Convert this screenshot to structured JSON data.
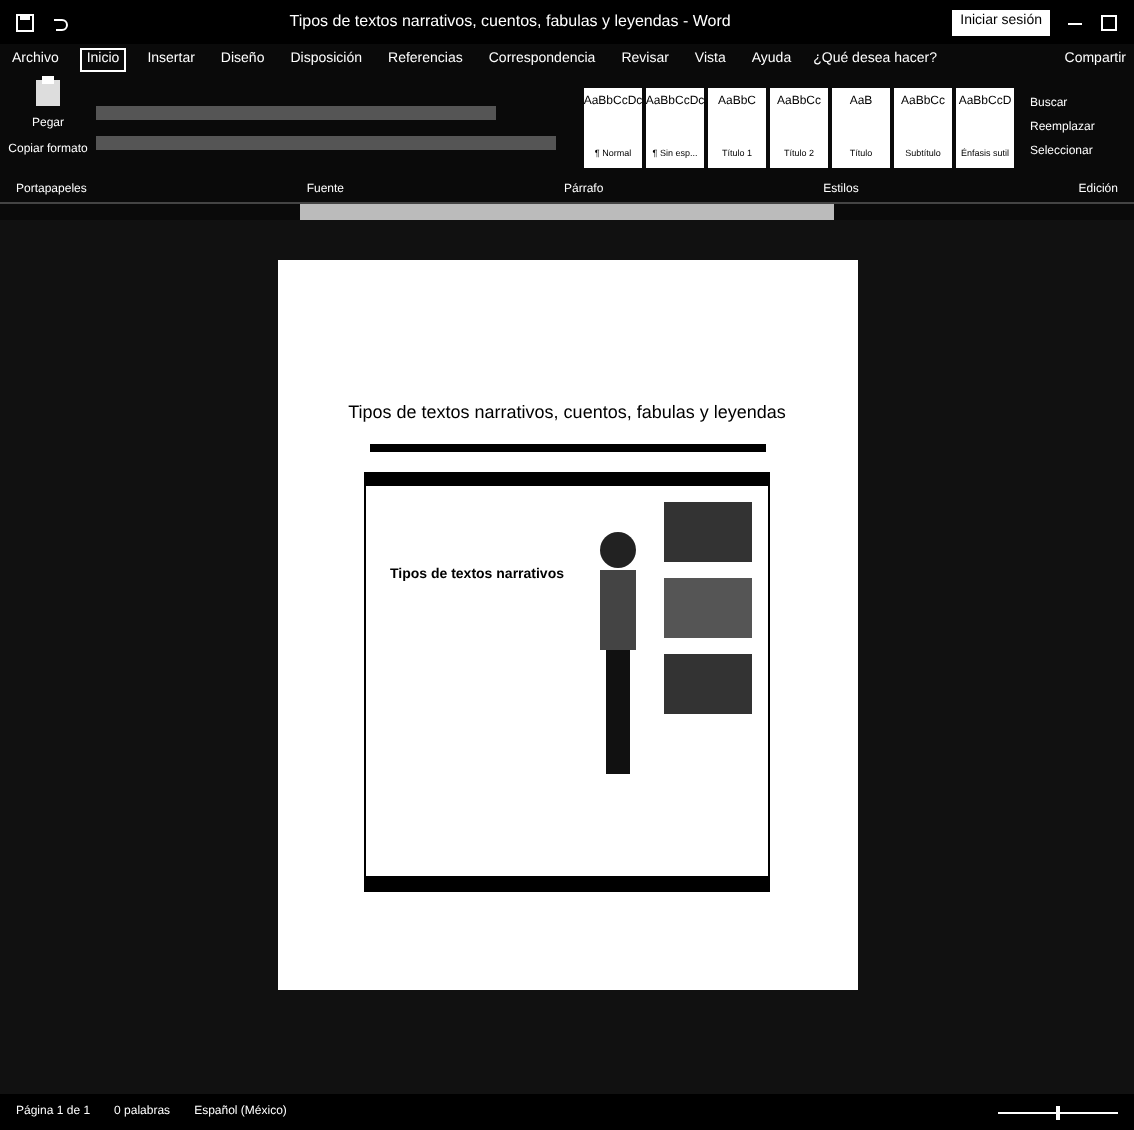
{
  "window": {
    "title": "Tipos de textos narrativos, cuentos, fabulas y leyendas - Word",
    "sign_in": "Iniciar sesión"
  },
  "ribbon_tabs": [
    {
      "label": "Archivo",
      "selected": false
    },
    {
      "label": "Inicio",
      "selected": true
    },
    {
      "label": "Insertar",
      "selected": false
    },
    {
      "label": "Diseño",
      "selected": false
    },
    {
      "label": "Disposición",
      "selected": false
    },
    {
      "label": "Referencias",
      "selected": false
    },
    {
      "label": "Correspondencia",
      "selected": false
    },
    {
      "label": "Revisar",
      "selected": false
    },
    {
      "label": "Vista",
      "selected": false
    },
    {
      "label": "Ayuda",
      "selected": false
    }
  ],
  "tell_me": "¿Qué desea hacer?",
  "share": "Compartir",
  "clipboard": {
    "paste": "Pegar",
    "format_painter": "Copiar formato"
  },
  "styles": [
    {
      "preview": "AaBbCcDc",
      "name": "¶ Normal"
    },
    {
      "preview": "AaBbCcDc",
      "name": "¶ Sin esp..."
    },
    {
      "preview": "AaBbC",
      "name": "Título 1"
    },
    {
      "preview": "AaBbCc",
      "name": "Título 2"
    },
    {
      "preview": "AaB",
      "name": "Título"
    },
    {
      "preview": "AaBbCc",
      "name": "Subtítulo"
    },
    {
      "preview": "AaBbCcD",
      "name": "Énfasis sutil"
    }
  ],
  "editing": [
    "Buscar",
    "Reemplazar",
    "Seleccionar"
  ],
  "groups": [
    "Portapapeles",
    "Fuente",
    "Párrafo",
    "Estilos",
    "Edición"
  ],
  "document": {
    "title": "Tipos de textos narrativos, cuentos, fabulas y leyendas",
    "embedded_heading": "Tipos de textos narrativos"
  },
  "status_bar": {
    "page": "Página 1 de 1",
    "words": "0 palabras",
    "language": "Español (México)",
    "zoom_slider": {
      "level": 0.5
    }
  }
}
